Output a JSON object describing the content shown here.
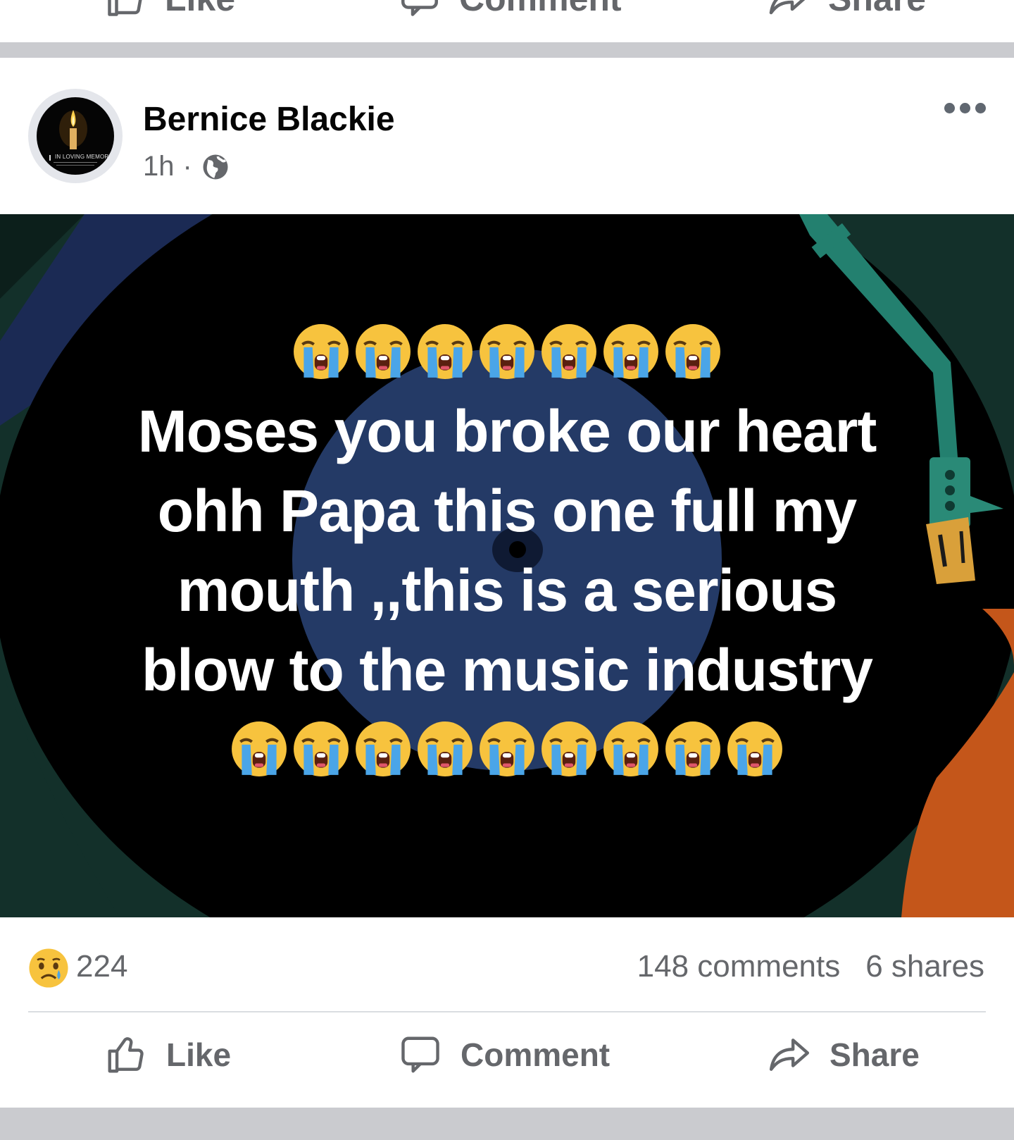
{
  "previous_post": {
    "actions": {
      "like_label": "Like",
      "comment_label": "Comment",
      "share_label": "Share"
    }
  },
  "post": {
    "author": "Bernice Blackie",
    "time": "1h",
    "separator": "·",
    "audience_icon": "globe-icon",
    "avatar": {
      "caption": "IN LOVING MEMORY",
      "icon": "candle-icon"
    },
    "more_icon": "more-options-icon",
    "image": {
      "emoji_top_count": 7,
      "emoji_bottom_count": 9,
      "emoji_icon": "loudly-crying-face-icon",
      "lines": [
        "Moses you broke our heart",
        "ohh Papa this one full my",
        "mouth ,,this is a serious",
        "blow to the music industry"
      ],
      "colors": {
        "disc_center": "#243a66",
        "tonearm": "#23806f",
        "accent_orange": "#c4561a",
        "background": "#000000"
      }
    },
    "stats": {
      "reaction_icon": "sad-face-icon",
      "reactions": "224",
      "comments": "148 comments",
      "shares": "6 shares"
    },
    "actions": {
      "like_label": "Like",
      "comment_label": "Comment",
      "share_label": "Share"
    }
  },
  "colors": {
    "text_primary": "#050505",
    "text_secondary": "#65676b",
    "separator": "#cacbcf"
  }
}
